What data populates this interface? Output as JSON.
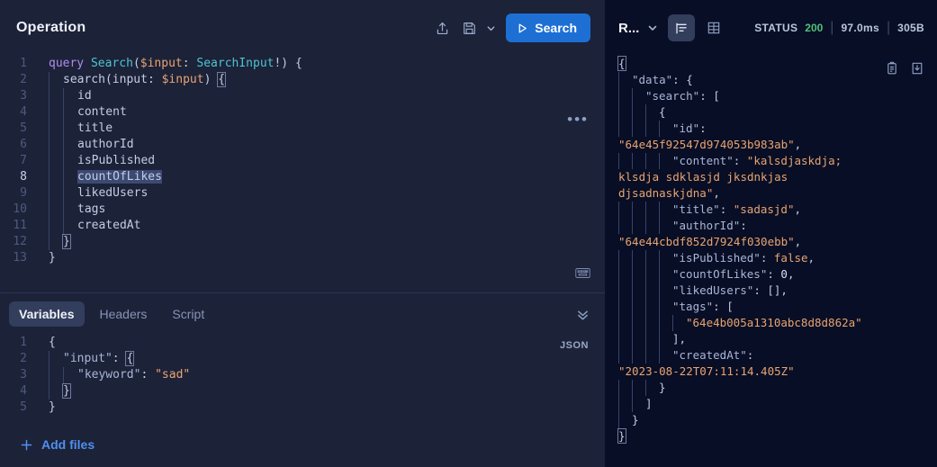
{
  "operation": {
    "title": "Operation",
    "toolbar": {
      "share_icon": "share-upload-icon",
      "save_icon": "floppy-save-icon",
      "save_chevron_icon": "chevron-down-icon",
      "run_label": "Search",
      "run_icon": "play-icon"
    },
    "more_menu": "•••",
    "keyboard_icon": "keyboard-shortcut-icon",
    "query_lines": [
      {
        "n": "1",
        "indent": 0,
        "active": false,
        "parts": [
          {
            "t": "query ",
            "c": "kw"
          },
          {
            "t": "Search",
            "c": "ty"
          },
          {
            "t": "(",
            "c": "punc"
          },
          {
            "t": "$input",
            "c": "var"
          },
          {
            "t": ": ",
            "c": "punc"
          },
          {
            "t": "SearchInput",
            "c": "ty"
          },
          {
            "t": "!) {",
            "c": "punc"
          }
        ]
      },
      {
        "n": "2",
        "indent": 1,
        "active": false,
        "parts": [
          {
            "t": "search",
            "c": "fld"
          },
          {
            "t": "(",
            "c": "punc"
          },
          {
            "t": "input",
            "c": "fld"
          },
          {
            "t": ": ",
            "c": "punc"
          },
          {
            "t": "$input",
            "c": "var"
          },
          {
            "t": ") ",
            "c": "punc"
          },
          {
            "t": "{",
            "c": "brmatch"
          }
        ]
      },
      {
        "n": "3",
        "indent": 2,
        "active": false,
        "parts": [
          {
            "t": "id",
            "c": "fld"
          }
        ]
      },
      {
        "n": "4",
        "indent": 2,
        "active": false,
        "parts": [
          {
            "t": "content",
            "c": "fld"
          }
        ]
      },
      {
        "n": "5",
        "indent": 2,
        "active": false,
        "parts": [
          {
            "t": "title",
            "c": "fld"
          }
        ]
      },
      {
        "n": "6",
        "indent": 2,
        "active": false,
        "parts": [
          {
            "t": "authorId",
            "c": "fld"
          }
        ]
      },
      {
        "n": "7",
        "indent": 2,
        "active": false,
        "parts": [
          {
            "t": "isPublished",
            "c": "fld"
          }
        ]
      },
      {
        "n": "8",
        "indent": 2,
        "active": true,
        "parts": [
          {
            "t": "countOfLikes",
            "c": "selhl"
          }
        ]
      },
      {
        "n": "9",
        "indent": 2,
        "active": false,
        "parts": [
          {
            "t": "likedUsers",
            "c": "fld"
          }
        ]
      },
      {
        "n": "10",
        "indent": 2,
        "active": false,
        "parts": [
          {
            "t": "tags",
            "c": "fld"
          }
        ]
      },
      {
        "n": "11",
        "indent": 2,
        "active": false,
        "parts": [
          {
            "t": "createdAt",
            "c": "fld"
          }
        ]
      },
      {
        "n": "12",
        "indent": 1,
        "active": false,
        "parts": [
          {
            "t": "}",
            "c": "brmatch"
          }
        ]
      },
      {
        "n": "13",
        "indent": 0,
        "active": false,
        "parts": [
          {
            "t": "}",
            "c": "punc"
          }
        ]
      }
    ]
  },
  "variables": {
    "tabs": [
      {
        "label": "Variables",
        "active": true
      },
      {
        "label": "Headers",
        "active": false
      },
      {
        "label": "Script",
        "active": false
      }
    ],
    "collapse_icon": "double-chevron-down-icon",
    "format_badge": "JSON",
    "lines": [
      {
        "n": "1",
        "indent": 0,
        "parts": [
          {
            "t": "{",
            "c": "punc"
          }
        ]
      },
      {
        "n": "2",
        "indent": 1,
        "parts": [
          {
            "t": "\"input\"",
            "c": "jkey"
          },
          {
            "t": ": ",
            "c": "punc"
          },
          {
            "t": "{",
            "c": "brmatch"
          }
        ]
      },
      {
        "n": "3",
        "indent": 2,
        "parts": [
          {
            "t": "\"keyword\"",
            "c": "jkey"
          },
          {
            "t": ": ",
            "c": "punc"
          },
          {
            "t": "\"sad\"",
            "c": "jstr"
          }
        ]
      },
      {
        "n": "4",
        "indent": 1,
        "parts": [
          {
            "t": "}",
            "c": "brmatch"
          }
        ]
      },
      {
        "n": "5",
        "indent": 0,
        "parts": [
          {
            "t": "}",
            "c": "punc"
          }
        ]
      }
    ],
    "add_files_label": "Add files",
    "add_files_icon": "plus-icon"
  },
  "response": {
    "label": "R...",
    "label_chevron_icon": "chevron-down-icon",
    "view_json_icon": "json-tree-view-icon",
    "view_table_icon": "table-view-icon",
    "status_label": "STATUS",
    "status_code": "200",
    "time": "97.0ms",
    "size": "305B",
    "copy_icon": "clipboard-copy-icon",
    "download_icon": "download-icon",
    "lines": [
      {
        "indent": 0,
        "parts": [
          {
            "t": "{",
            "c": "brmatch"
          }
        ]
      },
      {
        "indent": 1,
        "parts": [
          {
            "t": "\"data\"",
            "c": "jkey"
          },
          {
            "t": ": {",
            "c": "punc"
          }
        ]
      },
      {
        "indent": 2,
        "parts": [
          {
            "t": "\"search\"",
            "c": "jkey"
          },
          {
            "t": ": [",
            "c": "punc"
          }
        ]
      },
      {
        "indent": 3,
        "parts": [
          {
            "t": "{",
            "c": "punc"
          }
        ]
      },
      {
        "indent": 4,
        "parts": [
          {
            "t": "\"id\"",
            "c": "jkey"
          },
          {
            "t": ":",
            "c": "punc"
          }
        ]
      },
      {
        "indent": -1,
        "parts": [
          {
            "t": "\"64e45f92547d974053b983ab\"",
            "c": "jstr"
          },
          {
            "t": ",",
            "c": "punc"
          }
        ]
      },
      {
        "indent": 4,
        "parts": [
          {
            "t": "\"content\"",
            "c": "jkey"
          },
          {
            "t": ": ",
            "c": "punc"
          },
          {
            "t": "\"kalsdjaskdja;",
            "c": "jstr"
          }
        ]
      },
      {
        "indent": -1,
        "parts": [
          {
            "t": "klsdja sdklasjd jksdnkjas",
            "c": "jstr"
          }
        ]
      },
      {
        "indent": -1,
        "parts": [
          {
            "t": "djsadnaskjdna\"",
            "c": "jstr"
          },
          {
            "t": ",",
            "c": "punc"
          }
        ]
      },
      {
        "indent": 4,
        "parts": [
          {
            "t": "\"title\"",
            "c": "jkey"
          },
          {
            "t": ": ",
            "c": "punc"
          },
          {
            "t": "\"sadasjd\"",
            "c": "jstr"
          },
          {
            "t": ",",
            "c": "punc"
          }
        ]
      },
      {
        "indent": 4,
        "parts": [
          {
            "t": "\"authorId\"",
            "c": "jkey"
          },
          {
            "t": ":",
            "c": "punc"
          }
        ]
      },
      {
        "indent": -1,
        "parts": [
          {
            "t": "\"64e44cbdf852d7924f030ebb\"",
            "c": "jstr"
          },
          {
            "t": ",",
            "c": "punc"
          }
        ]
      },
      {
        "indent": 4,
        "parts": [
          {
            "t": "\"isPublished\"",
            "c": "jkey"
          },
          {
            "t": ": ",
            "c": "punc"
          },
          {
            "t": "false",
            "c": "rbool"
          },
          {
            "t": ",",
            "c": "punc"
          }
        ]
      },
      {
        "indent": 4,
        "parts": [
          {
            "t": "\"countOfLikes\"",
            "c": "jkey"
          },
          {
            "t": ": ",
            "c": "punc"
          },
          {
            "t": "0",
            "c": "rnum"
          },
          {
            "t": ",",
            "c": "punc"
          }
        ]
      },
      {
        "indent": 4,
        "parts": [
          {
            "t": "\"likedUsers\"",
            "c": "jkey"
          },
          {
            "t": ": [],",
            "c": "punc"
          }
        ]
      },
      {
        "indent": 4,
        "parts": [
          {
            "t": "\"tags\"",
            "c": "jkey"
          },
          {
            "t": ": [",
            "c": "punc"
          }
        ]
      },
      {
        "indent": 5,
        "parts": [
          {
            "t": "\"64e4b005a1310abc8d8d862a\"",
            "c": "jstr"
          }
        ]
      },
      {
        "indent": 4,
        "parts": [
          {
            "t": "],",
            "c": "punc"
          }
        ]
      },
      {
        "indent": 4,
        "parts": [
          {
            "t": "\"createdAt\"",
            "c": "jkey"
          },
          {
            "t": ":",
            "c": "punc"
          }
        ]
      },
      {
        "indent": -1,
        "parts": [
          {
            "t": "\"2023-08-22T07:11:14.405Z\"",
            "c": "jstr"
          }
        ]
      },
      {
        "indent": 3,
        "parts": [
          {
            "t": "}",
            "c": "punc"
          }
        ]
      },
      {
        "indent": 2,
        "parts": [
          {
            "t": "]",
            "c": "punc"
          }
        ]
      },
      {
        "indent": 1,
        "parts": [
          {
            "t": "}",
            "c": "punc"
          }
        ]
      },
      {
        "indent": 0,
        "parts": [
          {
            "t": "}",
            "c": "brmatch"
          }
        ]
      }
    ]
  },
  "colors": {
    "accent": "#1d6fd4",
    "left_bg": "#1c2238",
    "right_bg": "#080e25",
    "status_ok": "#52c07a",
    "link": "#4f8ff0",
    "keyword": "#b18cf0",
    "type": "#4fc4cf",
    "variable": "#e8a472",
    "string": "#e8a472"
  }
}
